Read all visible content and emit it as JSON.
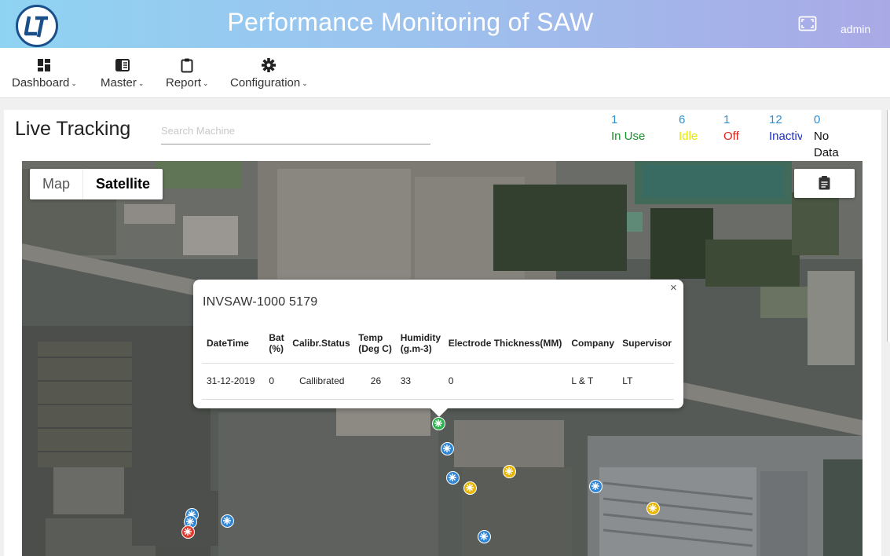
{
  "header": {
    "title": "Performance Monitoring of SAW",
    "user": "admin",
    "icons": {
      "logo": "company-logo",
      "fullscreen": "fullscreen-icon"
    },
    "colors": {
      "gradient_start": "#8fd3f2",
      "gradient_end": "#a9a9e6"
    }
  },
  "nav": {
    "items": [
      {
        "label": "Dashboard",
        "icon": "dashboard-grid-icon"
      },
      {
        "label": "Master",
        "icon": "book-icon"
      },
      {
        "label": "Report",
        "icon": "clipboard-icon"
      },
      {
        "label": "Configuration",
        "icon": "gear-icon"
      }
    ]
  },
  "tracking": {
    "title": "Live Tracking",
    "search_placeholder": "Search Machine",
    "stats": [
      {
        "count": "1",
        "label": "In Use",
        "color": "#1a8f2a"
      },
      {
        "count": "6",
        "label": "Idle",
        "color": "#e6e600"
      },
      {
        "count": "1",
        "label": "Off",
        "color": "#e0231a"
      },
      {
        "count": "12",
        "label": "Inactive",
        "color": "#1a2ec8"
      },
      {
        "count": "0",
        "label": "No Data",
        "color": "#111111"
      }
    ]
  },
  "map": {
    "type_map": "Map",
    "type_satellite": "Satellite",
    "selected_type": "Satellite",
    "report_icon": "clipboard-icon",
    "markers": [
      {
        "status": "In Use",
        "color": "#2bb24c"
      },
      {
        "status": "Inactive",
        "color": "#2f86d6"
      },
      {
        "status": "Inactive",
        "color": "#2f86d6"
      },
      {
        "status": "Idle",
        "color": "#e8b500"
      },
      {
        "status": "Idle",
        "color": "#e8b500"
      },
      {
        "status": "Inactive",
        "color": "#2f86d6"
      },
      {
        "status": "Idle",
        "color": "#e8b500"
      },
      {
        "status": "Inactive",
        "color": "#2f86d6"
      },
      {
        "status": "Inactive",
        "color": "#2f86d6"
      },
      {
        "status": "Inactive",
        "color": "#2f86d6"
      },
      {
        "status": "Off",
        "color": "#e0392c"
      },
      {
        "status": "Inactive",
        "color": "#2f86d6"
      }
    ]
  },
  "popup": {
    "machine": "INVSAW-1000 5179",
    "close": "×",
    "columns": [
      "DateTime",
      "Bat (%)",
      "Calibr.Status",
      "Temp (Deg C)",
      "Humidity (g.m-3)",
      "Electrode Thickness(MM)",
      "Company",
      "Supervisor"
    ],
    "row": [
      "31-12-2019",
      "0",
      "Callibrated",
      "26",
      "33",
      "0",
      "L & T",
      "LT"
    ]
  }
}
